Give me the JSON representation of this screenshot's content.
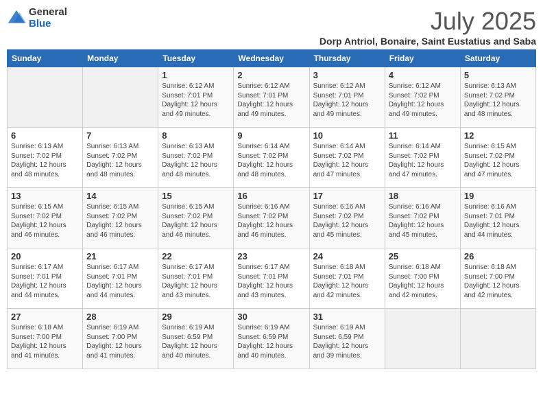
{
  "logo": {
    "general": "General",
    "blue": "Blue"
  },
  "title": "July 2025",
  "location": "Dorp Antriol, Bonaire, Saint Eustatius and Saba",
  "columns": [
    "Sunday",
    "Monday",
    "Tuesday",
    "Wednesday",
    "Thursday",
    "Friday",
    "Saturday"
  ],
  "weeks": [
    [
      {
        "day": "",
        "sunrise": "",
        "sunset": "",
        "daylight": ""
      },
      {
        "day": "",
        "sunrise": "",
        "sunset": "",
        "daylight": ""
      },
      {
        "day": "1",
        "sunrise": "Sunrise: 6:12 AM",
        "sunset": "Sunset: 7:01 PM",
        "daylight": "Daylight: 12 hours and 49 minutes."
      },
      {
        "day": "2",
        "sunrise": "Sunrise: 6:12 AM",
        "sunset": "Sunset: 7:01 PM",
        "daylight": "Daylight: 12 hours and 49 minutes."
      },
      {
        "day": "3",
        "sunrise": "Sunrise: 6:12 AM",
        "sunset": "Sunset: 7:01 PM",
        "daylight": "Daylight: 12 hours and 49 minutes."
      },
      {
        "day": "4",
        "sunrise": "Sunrise: 6:12 AM",
        "sunset": "Sunset: 7:02 PM",
        "daylight": "Daylight: 12 hours and 49 minutes."
      },
      {
        "day": "5",
        "sunrise": "Sunrise: 6:13 AM",
        "sunset": "Sunset: 7:02 PM",
        "daylight": "Daylight: 12 hours and 48 minutes."
      }
    ],
    [
      {
        "day": "6",
        "sunrise": "Sunrise: 6:13 AM",
        "sunset": "Sunset: 7:02 PM",
        "daylight": "Daylight: 12 hours and 48 minutes."
      },
      {
        "day": "7",
        "sunrise": "Sunrise: 6:13 AM",
        "sunset": "Sunset: 7:02 PM",
        "daylight": "Daylight: 12 hours and 48 minutes."
      },
      {
        "day": "8",
        "sunrise": "Sunrise: 6:13 AM",
        "sunset": "Sunset: 7:02 PM",
        "daylight": "Daylight: 12 hours and 48 minutes."
      },
      {
        "day": "9",
        "sunrise": "Sunrise: 6:14 AM",
        "sunset": "Sunset: 7:02 PM",
        "daylight": "Daylight: 12 hours and 48 minutes."
      },
      {
        "day": "10",
        "sunrise": "Sunrise: 6:14 AM",
        "sunset": "Sunset: 7:02 PM",
        "daylight": "Daylight: 12 hours and 47 minutes."
      },
      {
        "day": "11",
        "sunrise": "Sunrise: 6:14 AM",
        "sunset": "Sunset: 7:02 PM",
        "daylight": "Daylight: 12 hours and 47 minutes."
      },
      {
        "day": "12",
        "sunrise": "Sunrise: 6:15 AM",
        "sunset": "Sunset: 7:02 PM",
        "daylight": "Daylight: 12 hours and 47 minutes."
      }
    ],
    [
      {
        "day": "13",
        "sunrise": "Sunrise: 6:15 AM",
        "sunset": "Sunset: 7:02 PM",
        "daylight": "Daylight: 12 hours and 46 minutes."
      },
      {
        "day": "14",
        "sunrise": "Sunrise: 6:15 AM",
        "sunset": "Sunset: 7:02 PM",
        "daylight": "Daylight: 12 hours and 46 minutes."
      },
      {
        "day": "15",
        "sunrise": "Sunrise: 6:15 AM",
        "sunset": "Sunset: 7:02 PM",
        "daylight": "Daylight: 12 hours and 46 minutes."
      },
      {
        "day": "16",
        "sunrise": "Sunrise: 6:16 AM",
        "sunset": "Sunset: 7:02 PM",
        "daylight": "Daylight: 12 hours and 46 minutes."
      },
      {
        "day": "17",
        "sunrise": "Sunrise: 6:16 AM",
        "sunset": "Sunset: 7:02 PM",
        "daylight": "Daylight: 12 hours and 45 minutes."
      },
      {
        "day": "18",
        "sunrise": "Sunrise: 6:16 AM",
        "sunset": "Sunset: 7:02 PM",
        "daylight": "Daylight: 12 hours and 45 minutes."
      },
      {
        "day": "19",
        "sunrise": "Sunrise: 6:16 AM",
        "sunset": "Sunset: 7:01 PM",
        "daylight": "Daylight: 12 hours and 44 minutes."
      }
    ],
    [
      {
        "day": "20",
        "sunrise": "Sunrise: 6:17 AM",
        "sunset": "Sunset: 7:01 PM",
        "daylight": "Daylight: 12 hours and 44 minutes."
      },
      {
        "day": "21",
        "sunrise": "Sunrise: 6:17 AM",
        "sunset": "Sunset: 7:01 PM",
        "daylight": "Daylight: 12 hours and 44 minutes."
      },
      {
        "day": "22",
        "sunrise": "Sunrise: 6:17 AM",
        "sunset": "Sunset: 7:01 PM",
        "daylight": "Daylight: 12 hours and 43 minutes."
      },
      {
        "day": "23",
        "sunrise": "Sunrise: 6:17 AM",
        "sunset": "Sunset: 7:01 PM",
        "daylight": "Daylight: 12 hours and 43 minutes."
      },
      {
        "day": "24",
        "sunrise": "Sunrise: 6:18 AM",
        "sunset": "Sunset: 7:01 PM",
        "daylight": "Daylight: 12 hours and 42 minutes."
      },
      {
        "day": "25",
        "sunrise": "Sunrise: 6:18 AM",
        "sunset": "Sunset: 7:00 PM",
        "daylight": "Daylight: 12 hours and 42 minutes."
      },
      {
        "day": "26",
        "sunrise": "Sunrise: 6:18 AM",
        "sunset": "Sunset: 7:00 PM",
        "daylight": "Daylight: 12 hours and 42 minutes."
      }
    ],
    [
      {
        "day": "27",
        "sunrise": "Sunrise: 6:18 AM",
        "sunset": "Sunset: 7:00 PM",
        "daylight": "Daylight: 12 hours and 41 minutes."
      },
      {
        "day": "28",
        "sunrise": "Sunrise: 6:19 AM",
        "sunset": "Sunset: 7:00 PM",
        "daylight": "Daylight: 12 hours and 41 minutes."
      },
      {
        "day": "29",
        "sunrise": "Sunrise: 6:19 AM",
        "sunset": "Sunset: 6:59 PM",
        "daylight": "Daylight: 12 hours and 40 minutes."
      },
      {
        "day": "30",
        "sunrise": "Sunrise: 6:19 AM",
        "sunset": "Sunset: 6:59 PM",
        "daylight": "Daylight: 12 hours and 40 minutes."
      },
      {
        "day": "31",
        "sunrise": "Sunrise: 6:19 AM",
        "sunset": "Sunset: 6:59 PM",
        "daylight": "Daylight: 12 hours and 39 minutes."
      },
      {
        "day": "",
        "sunrise": "",
        "sunset": "",
        "daylight": ""
      },
      {
        "day": "",
        "sunrise": "",
        "sunset": "",
        "daylight": ""
      }
    ]
  ]
}
